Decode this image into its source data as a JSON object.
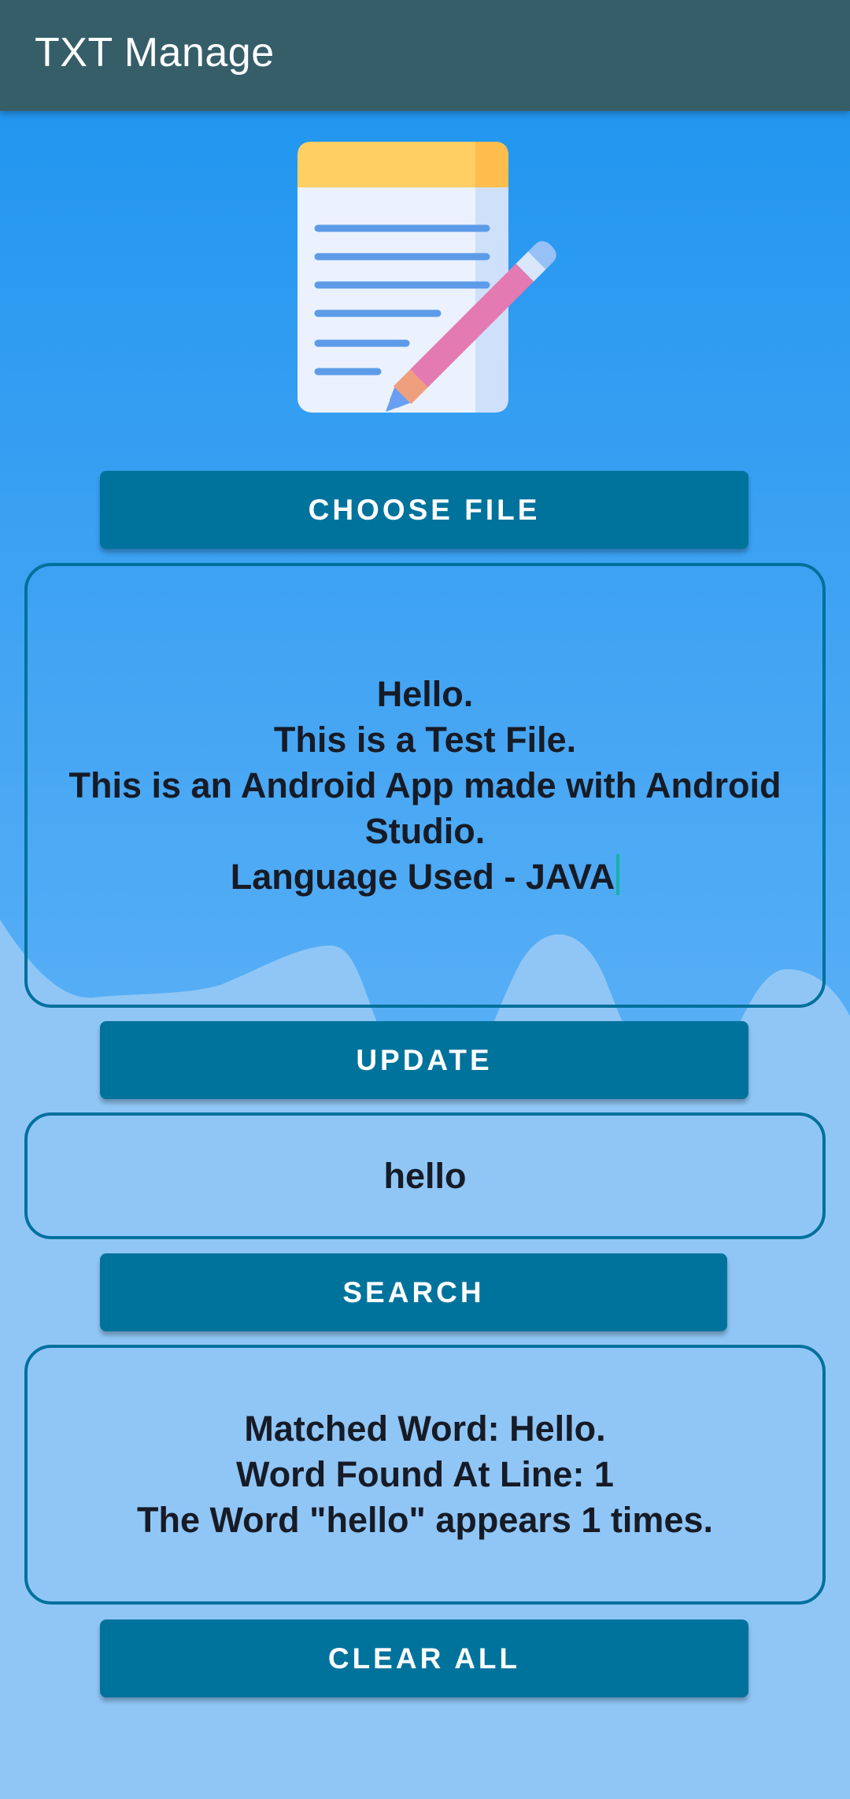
{
  "app": {
    "title": "TXT Manage",
    "colors": {
      "appbar": "#355e69",
      "button": "#00739c",
      "border": "#00719b",
      "background_top": "#2296f0",
      "background_bottom": "#90c6f6",
      "text": "#161b26"
    }
  },
  "logo": {
    "icon": "notepad-pencil-icon"
  },
  "buttons": {
    "choose_file": "CHOOSE FILE",
    "update": "UPDATE",
    "search": "SEARCH",
    "clear_all": "CLEAR ALL"
  },
  "file_content": {
    "value": "Hello.\nThis is a Test File.\nThis is an Android App made with Android Studio.\nLanguage Used - JAVA"
  },
  "search": {
    "value": "hello"
  },
  "result": {
    "text": "Matched Word: Hello.\nWord Found At Line: 1\nThe Word \"hello\" appears 1 times."
  }
}
